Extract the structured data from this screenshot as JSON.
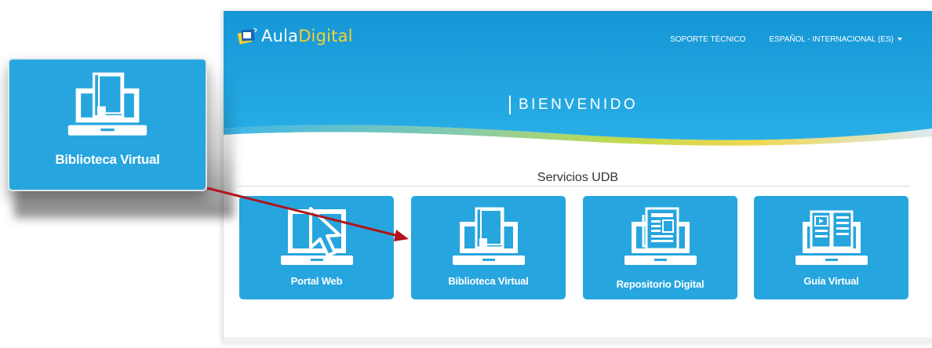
{
  "app": {
    "logo_prefix": "Aula",
    "logo_suffix": "Digital"
  },
  "nav": {
    "support": "SOPORTE TÉCNICO",
    "language": "ESPAÑOL - INTERNACIONAL (ES)"
  },
  "hero": {
    "welcome": "BIENVENIDO"
  },
  "services": {
    "title": "Servicios UDB",
    "items": [
      {
        "label": "Portal Web",
        "icon": "laptop-cursor-icon"
      },
      {
        "label": "Biblioteca Virtual",
        "icon": "laptop-book-icon"
      },
      {
        "label": "Repositorio Digital",
        "icon": "laptop-newspaper-icon"
      },
      {
        "label": "Guía Virtual",
        "icon": "laptop-open-book-icon"
      }
    ]
  },
  "callout": {
    "label": "Biblioteca Virtual",
    "icon": "laptop-book-icon"
  },
  "colors": {
    "primary": "#27a5de",
    "header_top": "#1596d6",
    "accent_yellow": "#f7d12e",
    "accent_green": "#9fcf3c",
    "arrow": "#b0151c"
  }
}
